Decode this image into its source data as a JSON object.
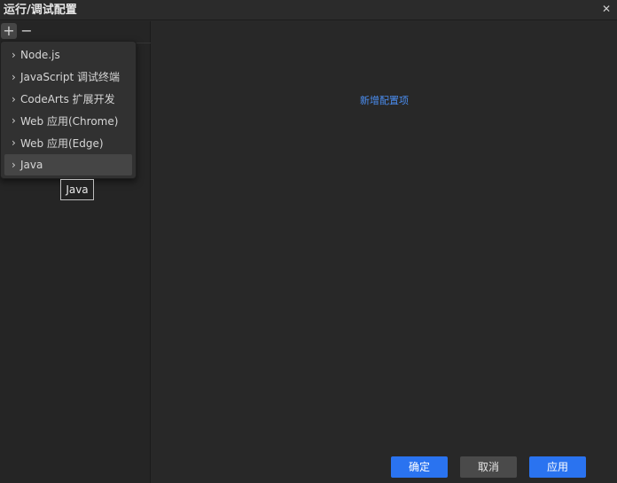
{
  "window": {
    "title": "运行/调试配置",
    "close_glyph": "✕"
  },
  "toolbar": {
    "add_glyph": "+",
    "remove_glyph": "−"
  },
  "dropdown": {
    "items": [
      {
        "label": "Node.js"
      },
      {
        "label": "JavaScript 调试终端"
      },
      {
        "label": "CodeArts 扩展开发"
      },
      {
        "label": "Web 应用(Chrome)"
      },
      {
        "label": "Web 应用(Edge)"
      },
      {
        "label": "Java"
      }
    ],
    "highlighted_index": 5,
    "chevron": "›"
  },
  "tooltip": {
    "text": "Java"
  },
  "main": {
    "new_config_link": "新增配置项"
  },
  "footer": {
    "ok_label": "确定",
    "cancel_label": "取消",
    "apply_label": "应用"
  },
  "colors": {
    "accent": "#2a73f0",
    "link": "#4a8df0",
    "background": "#282828"
  },
  "icons": {
    "add": "plus-icon",
    "remove": "minus-icon",
    "close": "close-icon",
    "expand": "chevron-right-icon"
  }
}
